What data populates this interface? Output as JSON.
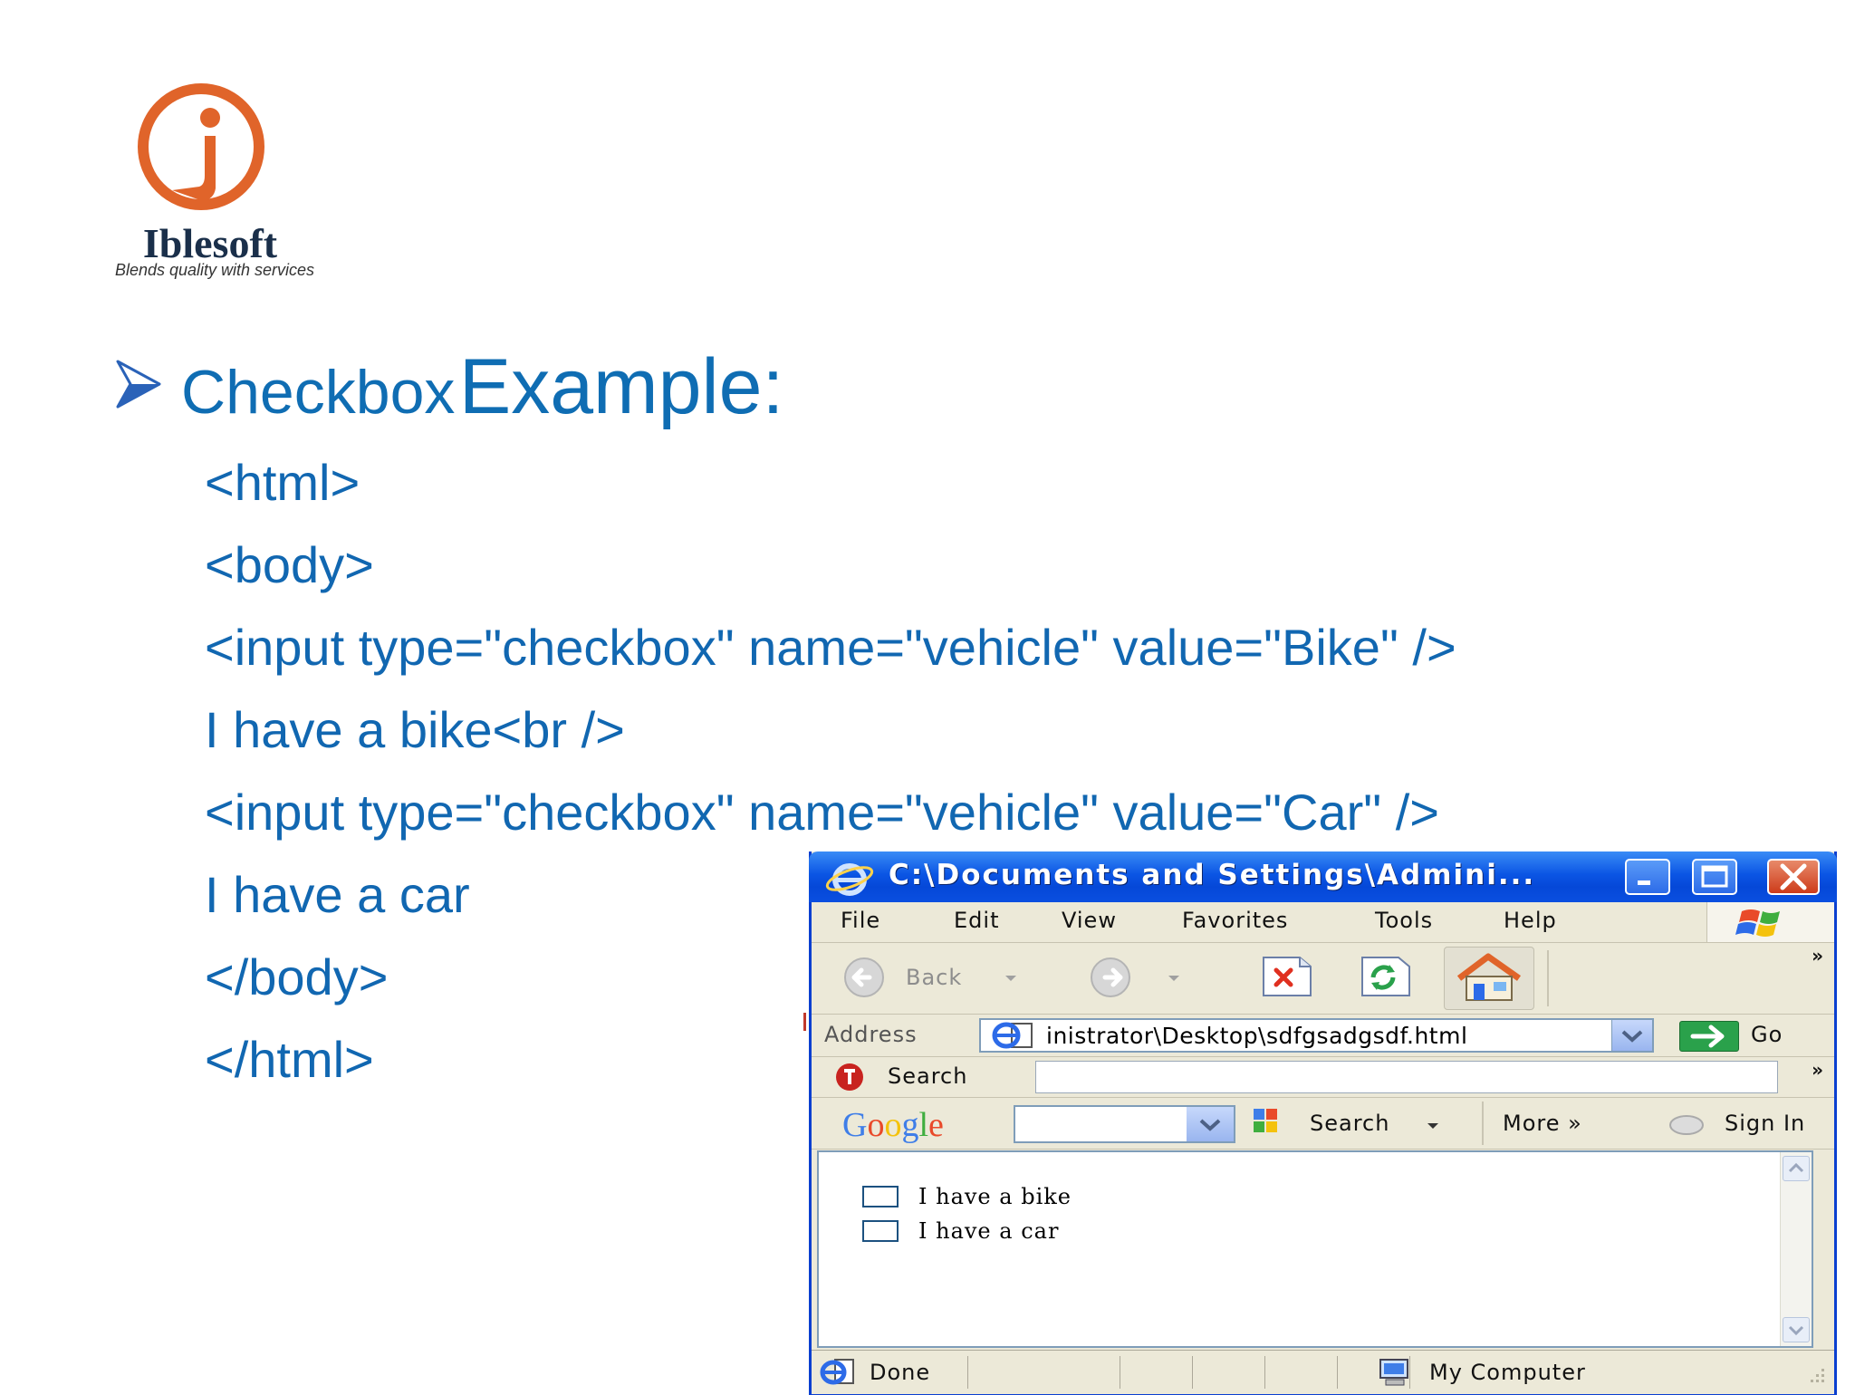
{
  "logo": {
    "name": "Iblesoft",
    "tagline": "Blends quality with services",
    "accent": "#e0642a"
  },
  "slide": {
    "heading_small": "Checkbox",
    "heading_big": "Example:",
    "text_color": "#1167b1",
    "code_lines": [
      "<html>",
      "<body>",
      "<input type=\"checkbox\" name=\"vehicle\" value=\"Bike\" />",
      "I have a bike<br />",
      "<input type=\"checkbox\" name=\"vehicle\" value=\"Car\" />",
      "I have a car",
      "</body>",
      "</html>"
    ]
  },
  "browser": {
    "title": "C:\\Documents and Settings\\Admini...",
    "menu": [
      "File",
      "Edit",
      "View",
      "Favorites",
      "Tools",
      "Help"
    ],
    "toolbar": {
      "back_label": "Back"
    },
    "address": {
      "label": "Address",
      "value": "inistrator\\Desktop\\sdfgsadgsdf.html",
      "go_label": "Go"
    },
    "search": {
      "label": "Search",
      "value": ""
    },
    "google": {
      "logo": "Google",
      "search_label": "Search",
      "more_label": "More",
      "signin_label": "Sign In"
    },
    "page": {
      "checkboxes": [
        {
          "label": "I have a bike",
          "checked": false
        },
        {
          "label": "I have a car",
          "checked": false
        }
      ]
    },
    "status": {
      "text": "Done",
      "zone": "My Computer"
    },
    "colors": {
      "titlebar": "#0b55e4",
      "chrome": "#ece9d8"
    }
  }
}
